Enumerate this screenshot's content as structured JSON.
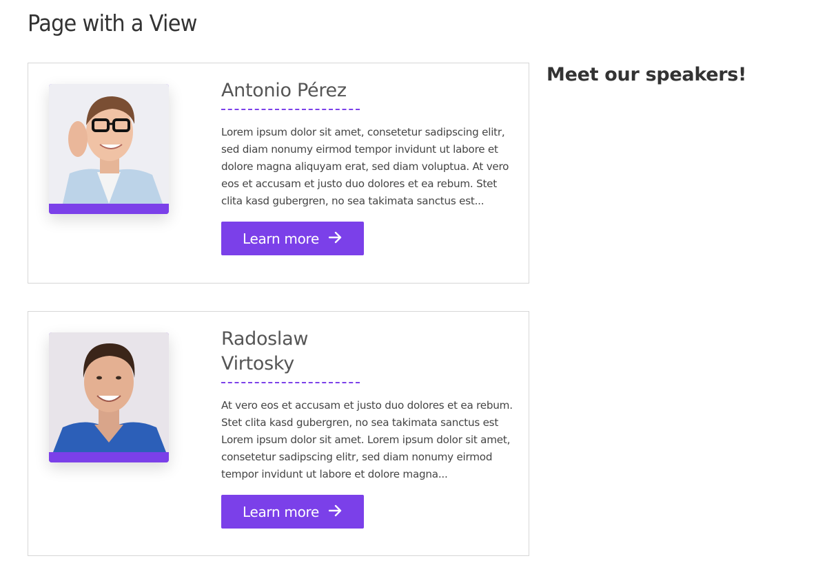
{
  "page": {
    "title": "Page with a View"
  },
  "sidebar": {
    "title": "Meet our speakers!"
  },
  "speakers": [
    {
      "name": "Antonio Pérez",
      "bio": "Lorem ipsum dolor sit amet, consetetur sadipscing elitr, sed diam nonumy eirmod tempor invidunt ut labore et dolore magna aliquyam erat, sed diam voluptua. At vero eos et accusam et justo duo dolores et ea rebum. Stet clita kasd gubergren, no sea takimata sanctus est...",
      "button_label": "Learn more",
      "button_icon": "arrow-right-icon"
    },
    {
      "name": "Radoslaw Virtosky",
      "bio": "At vero eos et accusam et justo duo dolores et ea rebum. Stet clita kasd gubergren, no sea takimata sanctus est Lorem ipsum dolor sit amet. Lorem ipsum dolor sit amet, consetetur sadipscing elitr, sed diam nonumy eirmod tempor invidunt ut labore et dolore magna...",
      "button_label": "Learn more",
      "button_icon": "arrow-right-icon"
    }
  ],
  "colors": {
    "accent": "#7b40e9",
    "border": "#d6d6d6",
    "text": "#333333"
  }
}
